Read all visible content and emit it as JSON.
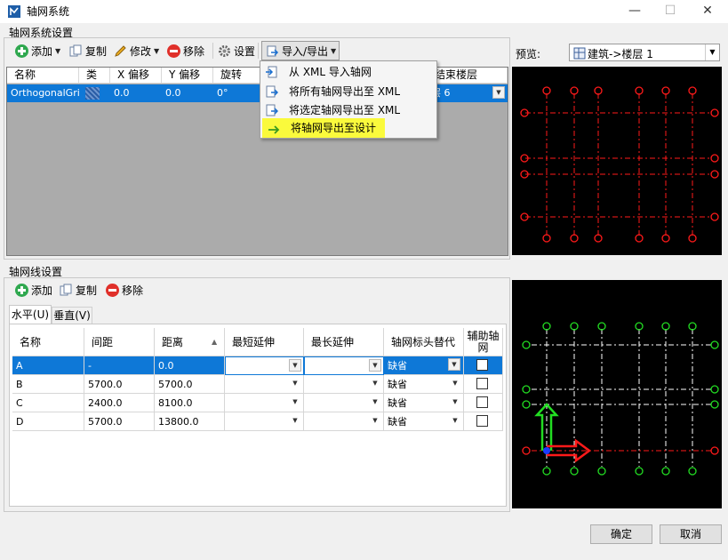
{
  "window": {
    "title": "轴网系统",
    "minimize": "—",
    "maximize": "☐",
    "close": "✕"
  },
  "system_section": {
    "label": "轴网系统设置",
    "toolbar": {
      "add": "添加",
      "copy": "复制",
      "edit": "修改",
      "remove": "移除",
      "settings": "设置",
      "import_export": "导入/导出"
    },
    "columns": [
      "名称",
      "类",
      "X 偏移",
      "Y 偏移",
      "旋转",
      "结束楼层"
    ],
    "row": {
      "name": "OrthogonalGrid",
      "x_offset": "0.0",
      "y_offset": "0.0",
      "rotation": "0°",
      "end_level": "层 6"
    }
  },
  "menu": {
    "items": [
      "从 XML 导入轴网",
      "将所有轴网导出至 XML",
      "将选定轴网导出至 XML",
      "将轴网导出至设计"
    ],
    "highlighted_index": 3
  },
  "preview": {
    "label": "预览:",
    "view_value": "建筑->楼层 1"
  },
  "line_section": {
    "label": "轴网线设置",
    "toolbar": {
      "add": "添加",
      "copy": "复制",
      "remove": "移除"
    },
    "tabs": [
      "水平(U)",
      "垂直(V)"
    ],
    "active_tab": 0,
    "columns": [
      "名称",
      "间距",
      "距离",
      "最短延伸",
      "最长延伸",
      "轴网标头替代",
      "辅助轴网"
    ],
    "rows": [
      {
        "name": "A",
        "spacing": "-",
        "distance": "0.0",
        "header": "缺省"
      },
      {
        "name": "B",
        "spacing": "5700.0",
        "distance": "5700.0",
        "header": "缺省"
      },
      {
        "name": "C",
        "spacing": "2400.0",
        "distance": "8100.0",
        "header": "缺省"
      },
      {
        "name": "D",
        "spacing": "5700.0",
        "distance": "13800.0",
        "header": "缺省"
      }
    ]
  },
  "buttons": {
    "ok": "确定",
    "cancel": "取消"
  },
  "colors": {
    "accent": "#0e78d7",
    "menu_highlight": "#fafa3c",
    "grid_red": "#ff1a1a",
    "grid_green": "#22dd22",
    "preview_bg": "#000000"
  }
}
